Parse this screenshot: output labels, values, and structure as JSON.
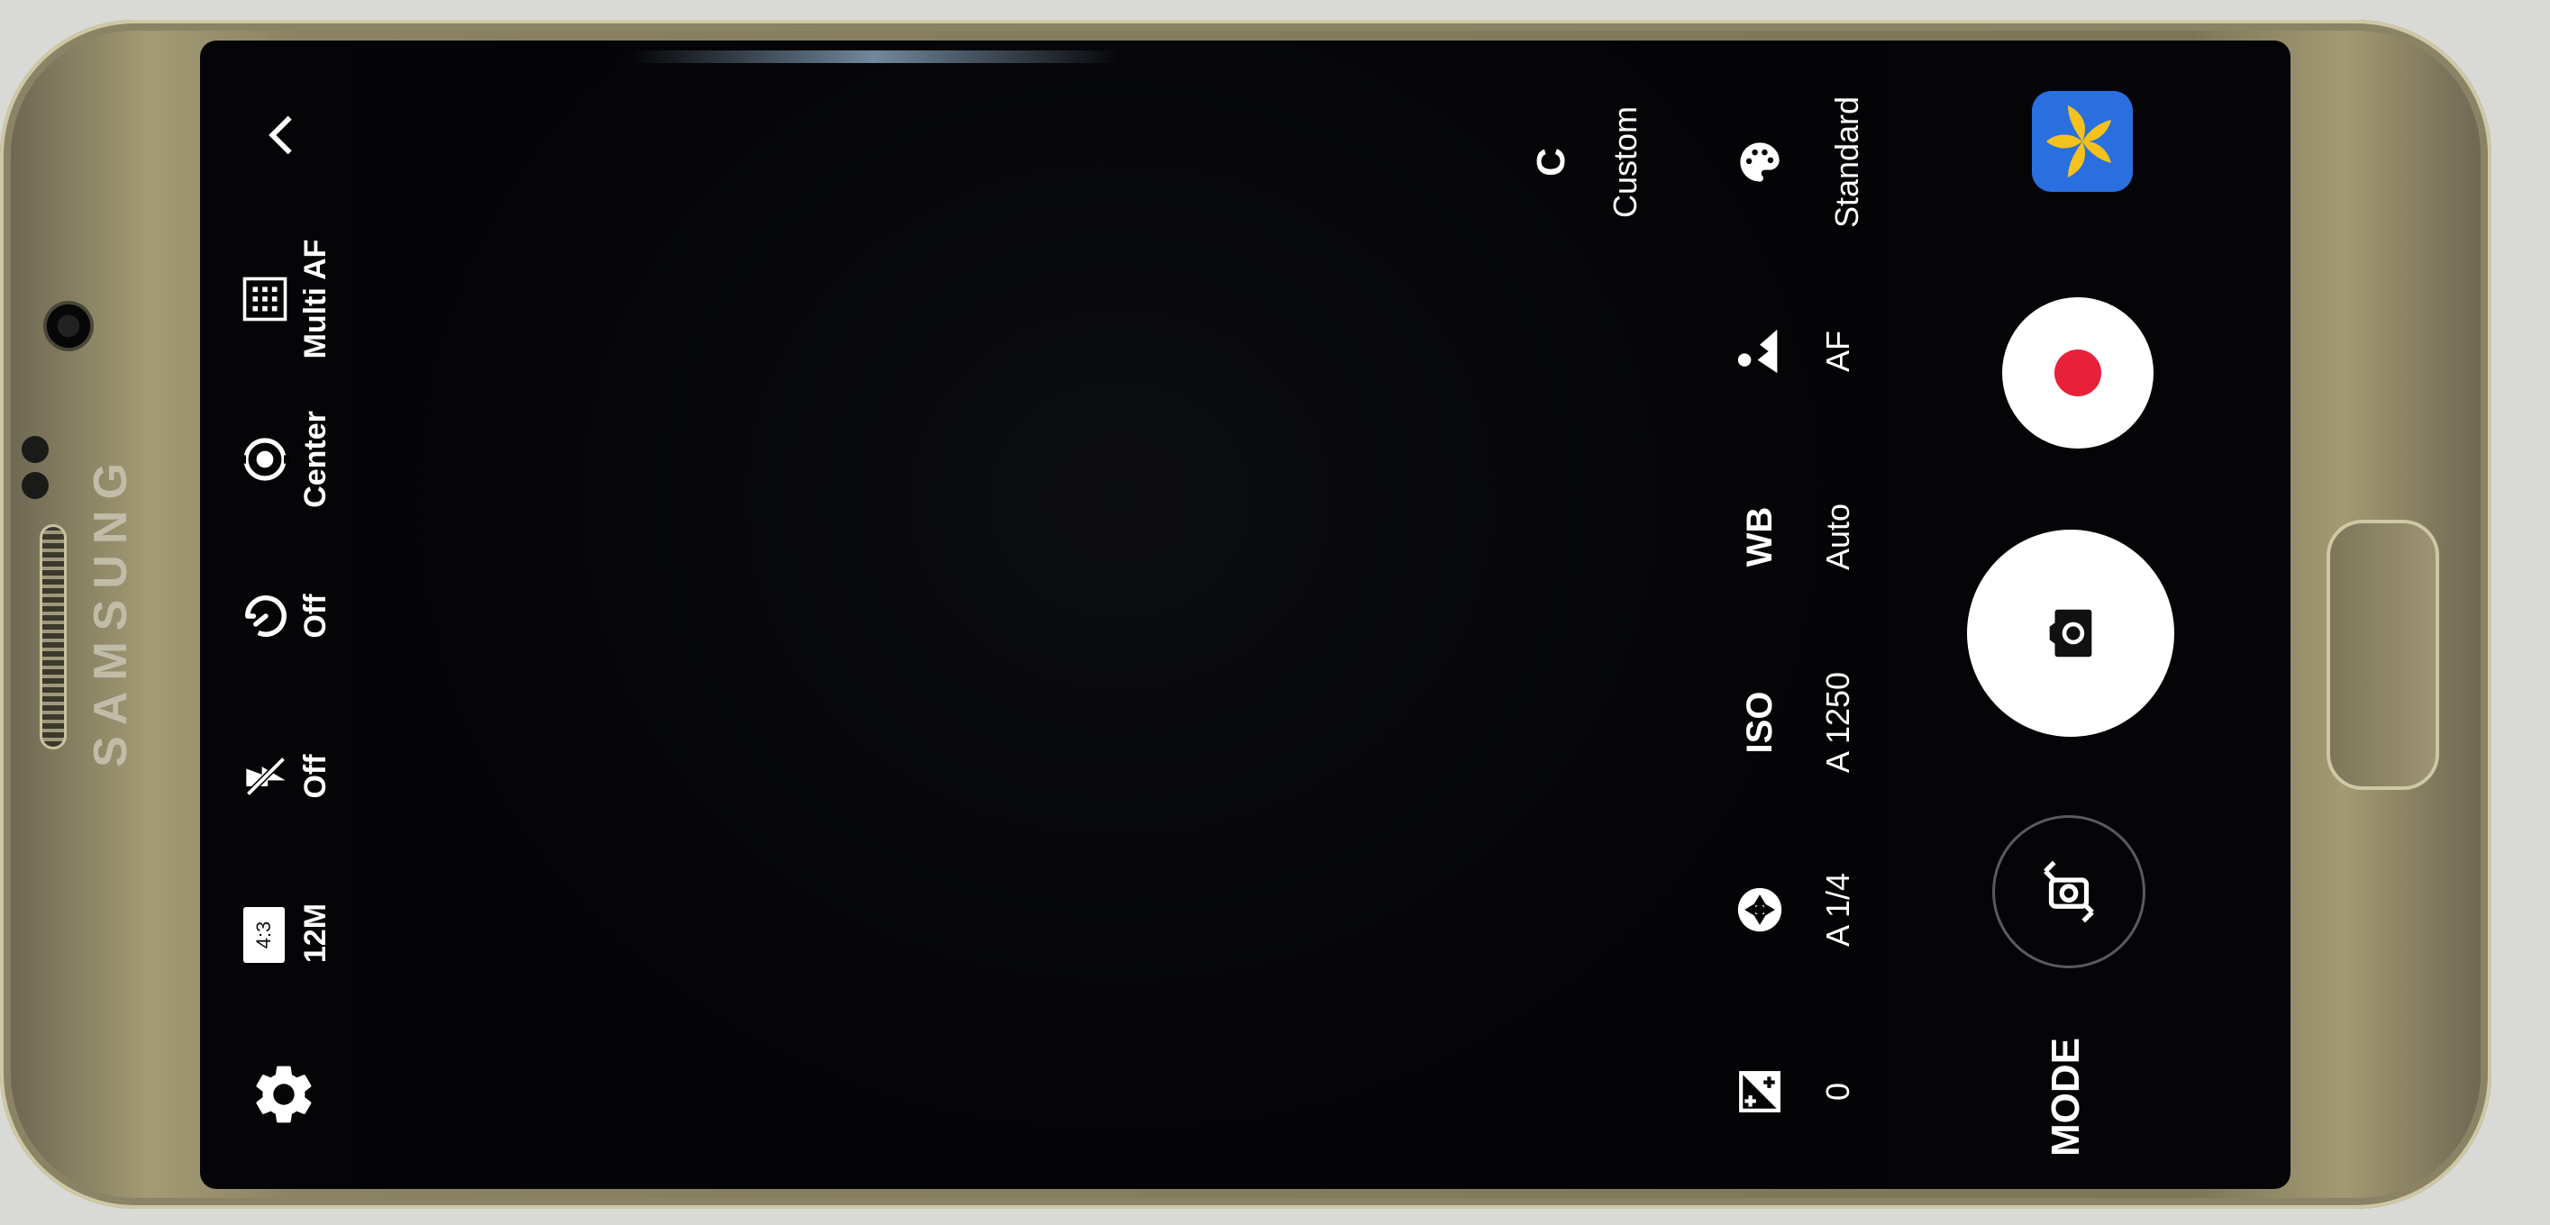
{
  "device": {
    "brand": "SAMSUNG"
  },
  "top_bar": {
    "settings_icon": "gear-icon",
    "picture_size": {
      "ratio": "4:3",
      "label": "12M"
    },
    "flash": {
      "label": "Off",
      "icon": "flash-off-icon"
    },
    "timer": {
      "label": "Off",
      "icon": "timer-icon"
    },
    "metering": {
      "label": "Center",
      "icon": "metering-center-icon"
    },
    "focus_area": {
      "label": "Multi AF",
      "icon": "multi-af-icon"
    },
    "expand_icon": "chevron-right-icon"
  },
  "pro_controls": {
    "exposure": {
      "value": "0",
      "icon": "exposure-icon"
    },
    "shutter_speed": {
      "value": "A 1/4",
      "icon": "aperture-icon"
    },
    "iso": {
      "label": "ISO",
      "value": "A 1250"
    },
    "wb": {
      "label": "WB",
      "value": "Auto"
    },
    "focus": {
      "value": "AF",
      "icon": "focus-icon"
    },
    "color_tone": {
      "value": "Standard",
      "icon": "palette-icon"
    },
    "custom": {
      "label": "C",
      "value": "Custom"
    }
  },
  "bottom_bar": {
    "mode_label": "MODE",
    "switch_camera_icon": "switch-camera-icon",
    "shutter_icon": "camera-icon",
    "record_icon": "record-icon",
    "gallery_icon": "gallery-thumbnail"
  },
  "colors": {
    "record_red": "#e8203a",
    "background": "#050507",
    "ui_white": "#ffffff"
  }
}
